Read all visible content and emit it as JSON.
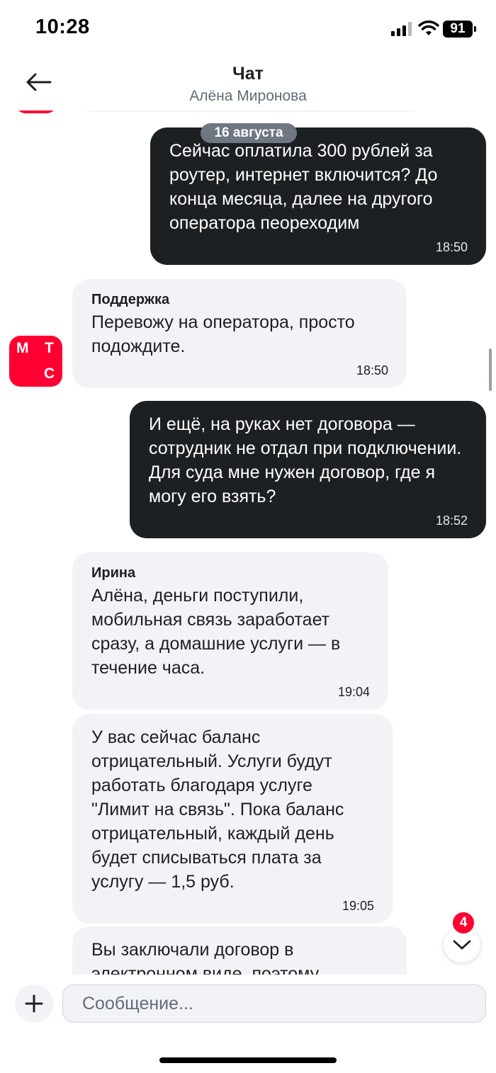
{
  "status_bar": {
    "time": "10:28",
    "battery": "91"
  },
  "header": {
    "title": "Чат",
    "subtitle": "Алёна Миронова"
  },
  "date_divider": "16 августа",
  "avatar": {
    "letters": [
      "М",
      "Т",
      "С"
    ]
  },
  "messages": [
    {
      "type": "outgoing",
      "text": "Сейчас оплатила 300 рублей за роутер, интернет включится? До конца месяца, далее на другого оператора пеореходим",
      "time": "18:50"
    },
    {
      "type": "incoming",
      "sender": "Поддержка",
      "text": "Перевожу на оператора, просто подождите.",
      "time": "18:50"
    },
    {
      "type": "outgoing",
      "text": "И ещё, на руках нет договора — сотрудник не отдал при подключении. Для суда мне нужен договор, где я могу его взять?",
      "time": "18:52"
    },
    {
      "type": "incoming",
      "sender": "Ирина",
      "text": "Алёна, деньги поступили, мобильная связь заработает сразу, а домашние услуги — в течение часа.",
      "time": "19:04"
    },
    {
      "type": "incoming",
      "text": "У вас сейчас баланс отрицательный. Услуги будут работать благодаря услуге \"Лимит на связь\". Пока баланс отрицательный, каждый день будет списываться плата за услугу — 1,5 руб.",
      "time": "19:05"
    },
    {
      "type": "incoming",
      "text": "Вы заключали договор в электронном виде, поэтому"
    }
  ],
  "unread_count": "4",
  "composer": {
    "placeholder": "Сообщение..."
  }
}
